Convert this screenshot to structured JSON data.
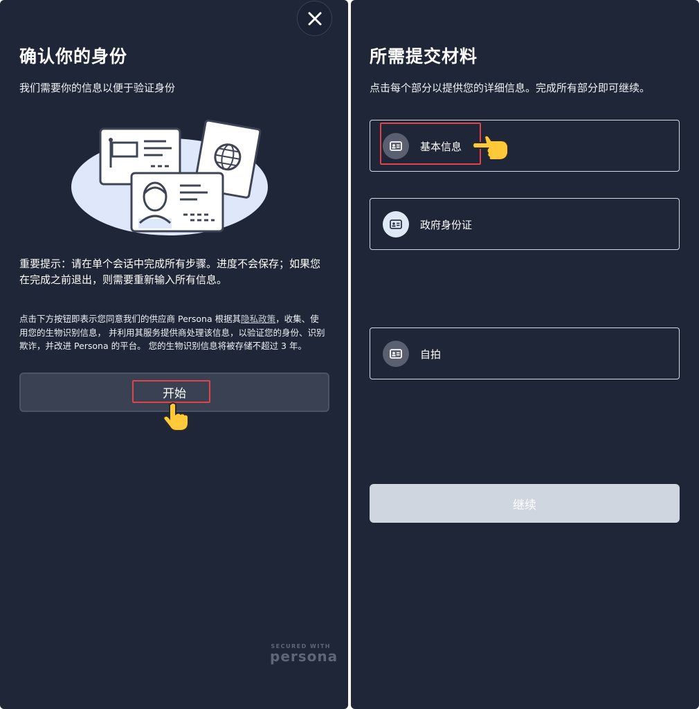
{
  "left": {
    "title": "确认你的身份",
    "subtitle": "我们需要你的信息以便于验证身份",
    "notice": "重要提示：请在单个会话中完成所有步骤。进度不会保存；如果您在完成之前退出，则需要重新输入所有信息。",
    "consent_before": "点击下方按钮即表示您同意我们的供应商 Persona 根据其",
    "consent_link": "隐私政策",
    "consent_after": "，收集、使用您的生物识别信息， 并利用其服务提供商处理该信息，以验证您的身份、识别欺诈，并改进 Persona 的平台。 您的生物识别信息将被存储不超过 3 年。",
    "start_button": "开始",
    "secured_with": "SECURED WITH",
    "brand": "persona"
  },
  "right": {
    "title": "所需提交材料",
    "subtitle": "点击每个部分以提供您的详细信息。完成所有部分即可继续。",
    "cards": [
      {
        "label": "基本信息",
        "icon": "id-card-icon"
      },
      {
        "label": "政府身份证",
        "icon": "id-card-icon"
      },
      {
        "label": "自拍",
        "icon": "id-card-icon"
      }
    ],
    "continue_button": "继续"
  },
  "colors": {
    "panel_bg": "#1f2637",
    "highlight": "#e2424a",
    "button_disabled": "#d0d6e0"
  }
}
